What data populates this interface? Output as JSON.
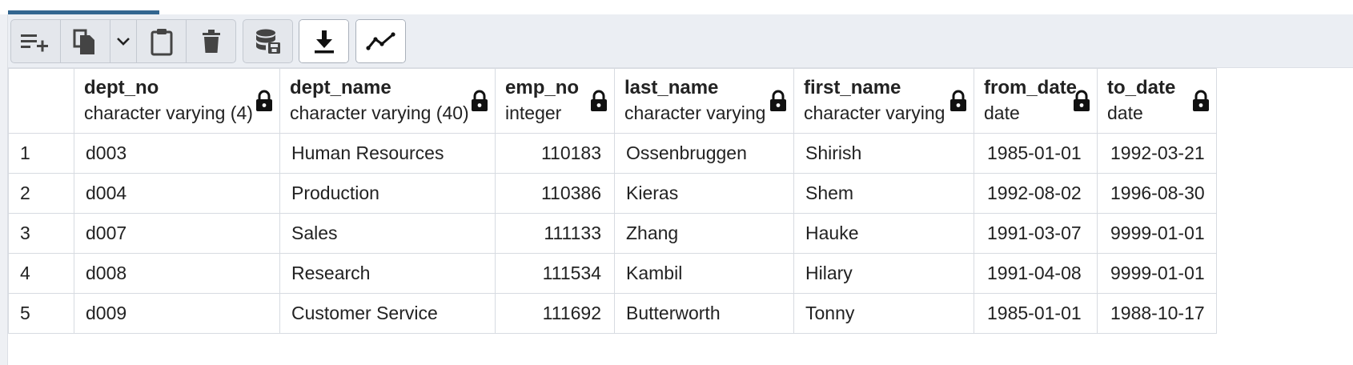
{
  "toolbar": {
    "buttons": [
      "add-row",
      "copy",
      "copy-dropdown",
      "paste",
      "delete",
      "save-data",
      "download",
      "graph"
    ]
  },
  "columns": [
    {
      "name": "dept_no",
      "type": "character varying (4)"
    },
    {
      "name": "dept_name",
      "type": "character varying (40)"
    },
    {
      "name": "emp_no",
      "type": "integer"
    },
    {
      "name": "last_name",
      "type": "character varying"
    },
    {
      "name": "first_name",
      "type": "character varying"
    },
    {
      "name": "from_date",
      "type": "date"
    },
    {
      "name": "to_date",
      "type": "date"
    }
  ],
  "rows": [
    {
      "n": "1",
      "dept_no": "d003",
      "dept_name": "Human Resources",
      "emp_no": "110183",
      "last_name": "Ossenbruggen",
      "first_name": "Shirish",
      "from_date": "1985-01-01",
      "to_date": "1992-03-21"
    },
    {
      "n": "2",
      "dept_no": "d004",
      "dept_name": "Production",
      "emp_no": "110386",
      "last_name": "Kieras",
      "first_name": "Shem",
      "from_date": "1992-08-02",
      "to_date": "1996-08-30"
    },
    {
      "n": "3",
      "dept_no": "d007",
      "dept_name": "Sales",
      "emp_no": "111133",
      "last_name": "Zhang",
      "first_name": "Hauke",
      "from_date": "1991-03-07",
      "to_date": "9999-01-01"
    },
    {
      "n": "4",
      "dept_no": "d008",
      "dept_name": "Research",
      "emp_no": "111534",
      "last_name": "Kambil",
      "first_name": "Hilary",
      "from_date": "1991-04-08",
      "to_date": "9999-01-01"
    },
    {
      "n": "5",
      "dept_no": "d009",
      "dept_name": "Customer Service",
      "emp_no": "111692",
      "last_name": "Butterworth",
      "first_name": "Tonny",
      "from_date": "1985-01-01",
      "to_date": "1988-10-17"
    }
  ]
}
